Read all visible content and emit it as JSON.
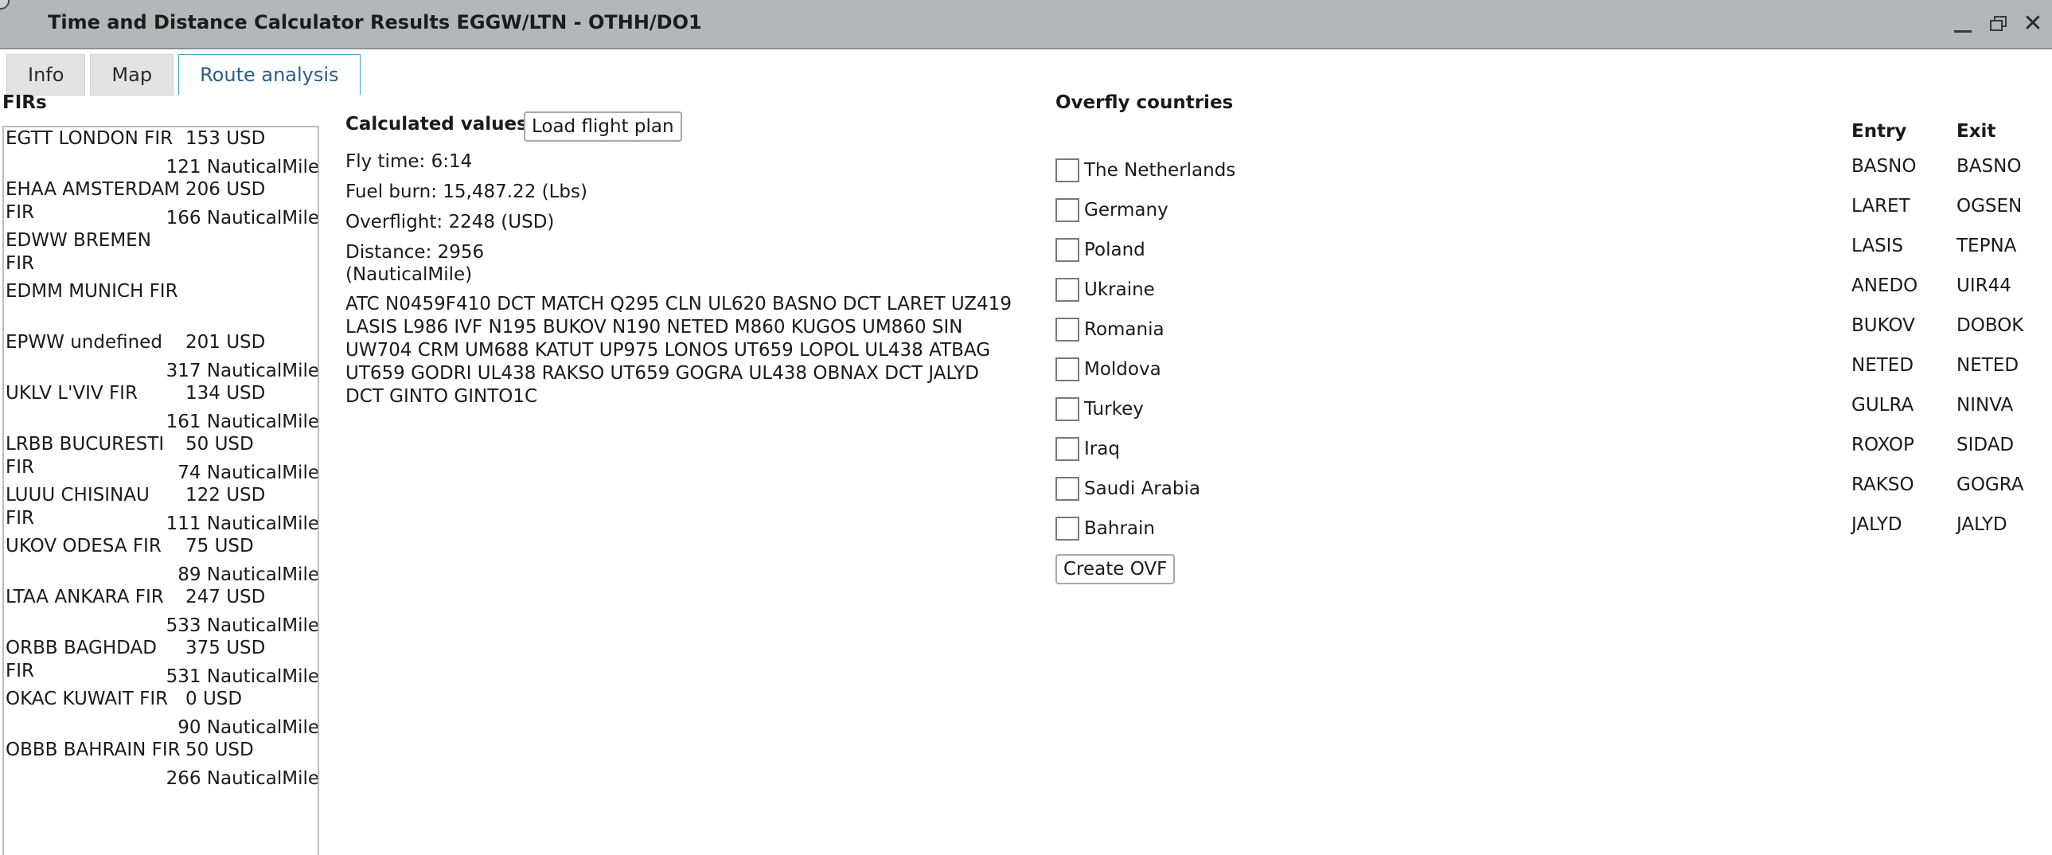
{
  "window": {
    "title": "Time and Distance Calculator Results EGGW/LTN - OTHH/DO1",
    "minimize_icon": "minimize-icon",
    "maximize_icon": "restore-icon",
    "close_glyph": "✕"
  },
  "tabs": [
    {
      "label": "Info",
      "active": false
    },
    {
      "label": "Map",
      "active": false
    },
    {
      "label": "Route analysis",
      "active": true
    }
  ],
  "firs": {
    "heading": "FIRs",
    "rows": [
      {
        "name": "EGTT LONDON FIR",
        "cost": "153 USD",
        "distance": "121 NauticalMile"
      },
      {
        "name": "EHAA AMSTERDAM FIR",
        "cost": "206 USD",
        "distance": "166 NauticalMile"
      },
      {
        "name": "EDWW BREMEN FIR",
        "cost": "",
        "distance": ""
      },
      {
        "name": "EDMM MUNICH FIR",
        "cost": "",
        "distance": ""
      },
      {
        "name": "EPWW undefined",
        "cost": "201 USD",
        "distance": "317 NauticalMile"
      },
      {
        "name": "UKLV L'VIV FIR",
        "cost": "134 USD",
        "distance": "161 NauticalMile"
      },
      {
        "name": "LRBB BUCURESTI FIR",
        "cost": "50 USD",
        "distance": "74 NauticalMile"
      },
      {
        "name": "LUUU CHISINAU FIR",
        "cost": "122 USD",
        "distance": "111 NauticalMile"
      },
      {
        "name": "UKOV ODESA FIR",
        "cost": "75 USD",
        "distance": "89 NauticalMile"
      },
      {
        "name": "LTAA ANKARA FIR",
        "cost": "247 USD",
        "distance": "533 NauticalMile"
      },
      {
        "name": "ORBB BAGHDAD FIR",
        "cost": "375 USD",
        "distance": "531 NauticalMile"
      },
      {
        "name": "OKAC KUWAIT FIR",
        "cost": "0 USD",
        "distance": "90 NauticalMile"
      },
      {
        "name": "OBBB BAHRAIN FIR",
        "cost": "50 USD",
        "distance": "266 NauticalMile"
      }
    ]
  },
  "calculated": {
    "heading": "Calculated values",
    "load_button": "Load flight plan",
    "fly_time": "Fly time: 6:14",
    "fuel_burn": "Fuel burn: 15,487.22 (Lbs)",
    "overflight": "Overflight: 2248 (USD)",
    "distance_line1": "Distance: 2956",
    "distance_line2": "(NauticalMile)",
    "route": "ATC N0459F410 DCT MATCH Q295 CLN UL620 BASNO DCT LARET UZ419 LASIS L986 IVF N195 BUKOV N190 NETED M860 KUGOS UM860 SIN UW704 CRM UM688 KATUT UP975 LONOS UT659 LOPOL UL438 ATBAG UT659 GODRI UL438 RAKSO UT659 GOGRA UL438 OBNAX DCT JALYD DCT GINTO GINTO1C"
  },
  "overfly": {
    "heading": "Overfly countries",
    "countries": [
      "The Netherlands",
      "Germany",
      "Poland",
      "Ukraine",
      "Romania",
      "Moldova",
      "Turkey",
      "Iraq",
      "Saudi Arabia",
      "Bahrain"
    ],
    "create_button": "Create OVF",
    "entry_header": "Entry",
    "exit_header": "Exit",
    "points": [
      {
        "entry": "BASNO",
        "exit": "BASNO"
      },
      {
        "entry": "LARET",
        "exit": "OGSEN"
      },
      {
        "entry": "LASIS",
        "exit": "TEPNA"
      },
      {
        "entry": "ANEDO",
        "exit": "UIR44"
      },
      {
        "entry": "BUKOV",
        "exit": "DOBOK"
      },
      {
        "entry": "NETED",
        "exit": "NETED"
      },
      {
        "entry": "GULRA",
        "exit": "NINVA"
      },
      {
        "entry": "ROXOP",
        "exit": "SIDAD"
      },
      {
        "entry": "RAKSO",
        "exit": "GOGRA"
      },
      {
        "entry": "JALYD",
        "exit": "JALYD"
      }
    ]
  }
}
